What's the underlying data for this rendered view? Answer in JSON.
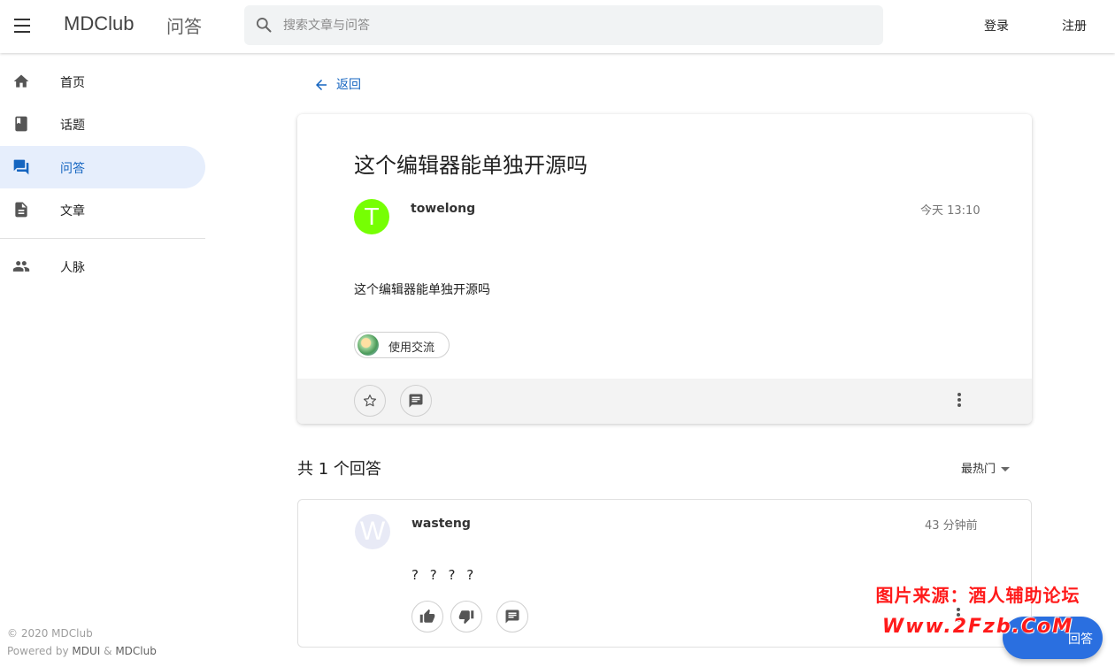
{
  "header": {
    "brand": "MDClub",
    "section": "问答",
    "search_placeholder": "搜索文章与问答",
    "login": "登录",
    "register": "注册"
  },
  "sidebar": {
    "items": [
      {
        "label": "首页",
        "icon": "home-icon"
      },
      {
        "label": "话题",
        "icon": "book-icon"
      },
      {
        "label": "问答",
        "icon": "forum-icon",
        "active": true
      },
      {
        "label": "文章",
        "icon": "description-icon"
      },
      {
        "label": "人脉",
        "icon": "people-icon"
      }
    ],
    "footer_line1": "© 2020 MDClub",
    "footer_powered": "Powered by",
    "footer_mdui": "MDUI",
    "footer_amp": "&",
    "footer_mdclub": "MDClub"
  },
  "main": {
    "back": "返回",
    "question": {
      "title": "这个编辑器能单独开源吗",
      "author": "towelong",
      "avatar_letter": "T",
      "avatar_color": "#76ff03",
      "time": "今天 13:10",
      "body": "这个编辑器能单独开源吗",
      "topic": "使用交流"
    },
    "answers_header": "共 1 个回答",
    "sort_label": "最热门",
    "answer": {
      "author": "wasteng",
      "avatar_letter": "W",
      "avatar_color": "#e8eaf6",
      "time": "43 分钟前",
      "body": "? ? ? ?"
    },
    "fab_label": "回答"
  },
  "watermark": {
    "line1": "图片来源：酒人辅助论坛",
    "line2": "Www.2Fzb.CoM"
  },
  "colors": {
    "accent": "#1565c0",
    "active_bg": "#e6eefc",
    "fab": "#2a6fe0"
  }
}
